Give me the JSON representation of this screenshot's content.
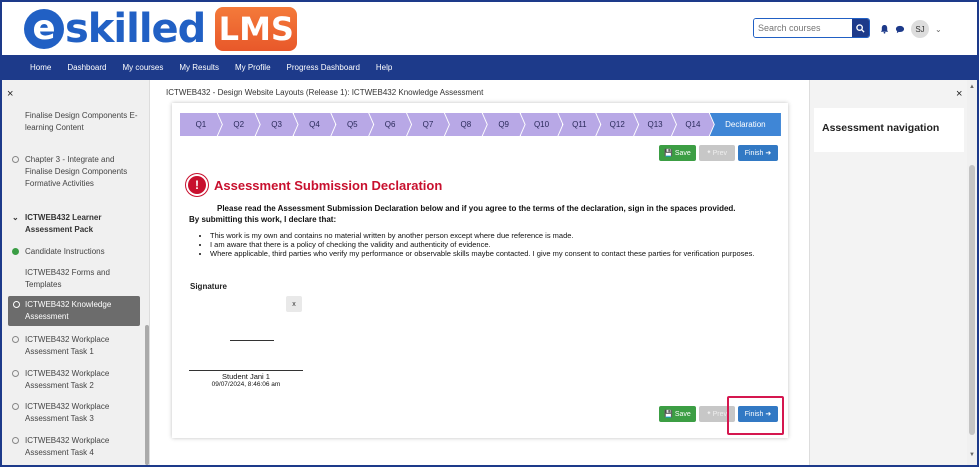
{
  "header": {
    "logo_text": "skilled",
    "logo_e": "e",
    "logo_badge": "LMS",
    "search_placeholder": "Search courses",
    "avatar_initials": "SJ"
  },
  "navbar": {
    "items": [
      "Home",
      "Dashboard",
      "My courses",
      "My Results",
      "My Profile",
      "Progress Dashboard",
      "Help"
    ]
  },
  "left_drawer": {
    "close": "×",
    "items": [
      {
        "label": "Finalise Design Components E-learning Content",
        "state": "none"
      },
      {
        "label": "Chapter 3 - Integrate and Finalise Design Components Formative Activities",
        "state": "empty"
      },
      {
        "label": "ICTWEB432 Learner Assessment Pack",
        "state": "heading"
      },
      {
        "label": "Candidate Instructions",
        "state": "done"
      },
      {
        "label": "ICTWEB432 Forms and Templates",
        "state": "none"
      },
      {
        "label": "ICTWEB432 Knowledge Assessment",
        "state": "active"
      },
      {
        "label": "ICTWEB432 Workplace Assessment Task 1",
        "state": "empty"
      },
      {
        "label": "ICTWEB432 Workplace Assessment Task 2",
        "state": "empty"
      },
      {
        "label": "ICTWEB432 Workplace Assessment Task 3",
        "state": "empty"
      },
      {
        "label": "ICTWEB432 Workplace Assessment Task 4",
        "state": "empty"
      }
    ]
  },
  "main": {
    "breadcrumb": "ICTWEB432 - Design Website Layouts (Release 1): ICTWEB432 Knowledge Assessment",
    "question_tabs": [
      "Q1",
      "Q2",
      "Q3",
      "Q4",
      "Q5",
      "Q6",
      "Q7",
      "Q8",
      "Q9",
      "Q10",
      "Q11",
      "Q12",
      "Q13",
      "Q14",
      "Declaration"
    ],
    "buttons": {
      "save": "Save",
      "prev": "Prev",
      "finish": "Finish"
    },
    "declaration": {
      "icon": "!",
      "title": "Assessment Submission Declaration",
      "intro": "Please read the Assessment Submission Declaration below and if you agree to the terms of the declaration, sign in the spaces provided.",
      "by_submitting": "By submitting this work, I declare that:",
      "bullets": [
        "This work is my own and contains no material written by another person except where due reference is made.",
        "I am aware that there is a policy of checking the validity and authenticity of evidence.",
        "Where applicable, third parties who verify my performance or observable skills maybe contacted. I give my consent to contact these parties for verification purposes."
      ]
    },
    "signature": {
      "label": "Signature",
      "clear": "x",
      "name": "Student Jani 1",
      "date": "09/07/2024, 8:46:06 am"
    }
  },
  "right_drawer": {
    "close": "×",
    "title": "Assessment navigation"
  }
}
